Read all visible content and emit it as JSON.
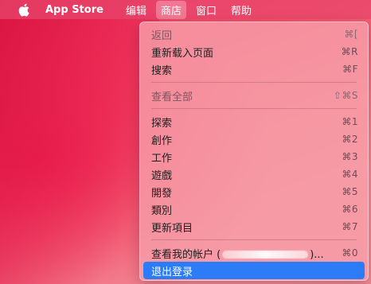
{
  "menubar": {
    "app_name": "App Store",
    "menus": [
      "编辑",
      "商店",
      "窗口",
      "帮助"
    ]
  },
  "store_menu": {
    "back": {
      "label": "返回",
      "shortcut": "⌘["
    },
    "reload": {
      "label": "重新载入页面",
      "shortcut": "⌘R"
    },
    "search": {
      "label": "搜索",
      "shortcut": "⌘F"
    },
    "view_all": {
      "label": "查看全部",
      "shortcut": "⇧⌘S"
    },
    "discover": {
      "label": "探索",
      "shortcut": "⌘1"
    },
    "create": {
      "label": "創作",
      "shortcut": "⌘2"
    },
    "work": {
      "label": "工作",
      "shortcut": "⌘3"
    },
    "play": {
      "label": "遊戲",
      "shortcut": "⌘4"
    },
    "develop": {
      "label": "開發",
      "shortcut": "⌘5"
    },
    "categories": {
      "label": "類別",
      "shortcut": "⌘6"
    },
    "updates": {
      "label": "更新項目",
      "shortcut": "⌘7"
    },
    "account": {
      "label_prefix": "查看我的帐户 (",
      "label_suffix": ")...",
      "shortcut": "⌘0"
    },
    "sign_out": {
      "label": "退出登录"
    }
  },
  "colors": {
    "highlight": "#2b7cf6"
  },
  "icons": {
    "apple": "apple-logo-icon"
  }
}
